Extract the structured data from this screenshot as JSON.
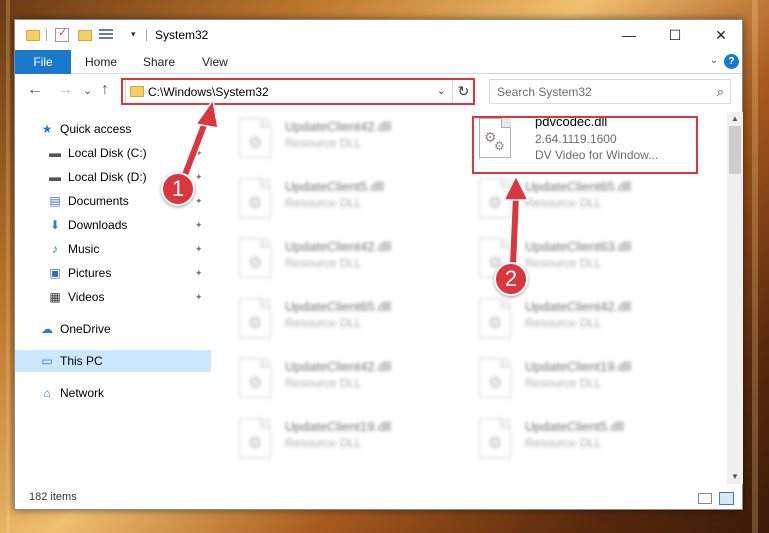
{
  "window": {
    "title": "System32",
    "controls": {
      "minimize": "—",
      "maximize": "☐",
      "close": "✕"
    }
  },
  "quick_access_toolbar": {
    "dropdown": "▾"
  },
  "ribbon": {
    "tabs": [
      "File",
      "Home",
      "Share",
      "View"
    ],
    "toggle": "⌄",
    "help": "?"
  },
  "navigation": {
    "back": "←",
    "forward": "→",
    "recent": "⌄",
    "up": "↑",
    "address": "C:\\Windows\\System32",
    "address_chevron": "⌄",
    "refresh": "↻",
    "search_placeholder": "Search System32",
    "search_icon": "⌕"
  },
  "sidebar": {
    "pin_glyph": "✦",
    "items": [
      {
        "label": "Quick access",
        "icon": "★",
        "color": "#2a7ad8"
      },
      {
        "label": "Local Disk (C:)",
        "icon": "▬",
        "color": "#555555"
      },
      {
        "label": "Local Disk (D:)",
        "icon": "▬",
        "color": "#555555"
      },
      {
        "label": "Documents",
        "icon": "▤",
        "color": "#3a6db5"
      },
      {
        "label": "Downloads",
        "icon": "⬇",
        "color": "#2a7ad8"
      },
      {
        "label": "Music",
        "icon": "♪",
        "color": "#2a7ad8"
      },
      {
        "label": "Pictures",
        "icon": "▣",
        "color": "#3a6db5"
      },
      {
        "label": "Videos",
        "icon": "▦",
        "color": "#333333"
      },
      {
        "label": "OneDrive",
        "icon": "☁",
        "color": "#2a7ad8"
      },
      {
        "label": "This PC",
        "icon": "▭",
        "color": "#2a7ad8"
      },
      {
        "label": "Network",
        "icon": "⌂",
        "color": "#2a7ad8"
      }
    ]
  },
  "files": {
    "left_column": [
      {
        "name": "UpdateClient42.dll",
        "type": "Resource DLL"
      },
      {
        "name": "UpdateClient5.dll",
        "type": "Resource DLL"
      },
      {
        "name": "UpdateClient42.dll",
        "type": "Resource DLL"
      },
      {
        "name": "UpdateClient65.dll",
        "type": "Resource DLL"
      },
      {
        "name": "UpdateClient42.dll",
        "type": "Resource DLL"
      },
      {
        "name": "UpdateClient19.dll",
        "type": "Resource DLL"
      }
    ],
    "highlighted": {
      "name": "pdvcodec.dll",
      "version": "2.64.1119.1600",
      "description": "DV Video for Window..."
    },
    "right_column": [
      {
        "name": "UpdateClient65.dll",
        "type": "Resource DLL"
      },
      {
        "name": "UpdateClient63.dll",
        "type": "Resource DLL"
      },
      {
        "name": "UpdateClient42.dll",
        "type": "Resource DLL"
      },
      {
        "name": "UpdateClient19.dll",
        "type": "Resource DLL"
      },
      {
        "name": "UpdateClient5.dll",
        "type": "Resource DLL"
      }
    ]
  },
  "status_bar": {
    "item_count": "182 items"
  },
  "scrollbar": {
    "up": "▲",
    "down": "▼"
  },
  "annotations": [
    {
      "number": "1",
      "color": "#d9363e"
    },
    {
      "number": "2",
      "color": "#d9363e"
    }
  ]
}
